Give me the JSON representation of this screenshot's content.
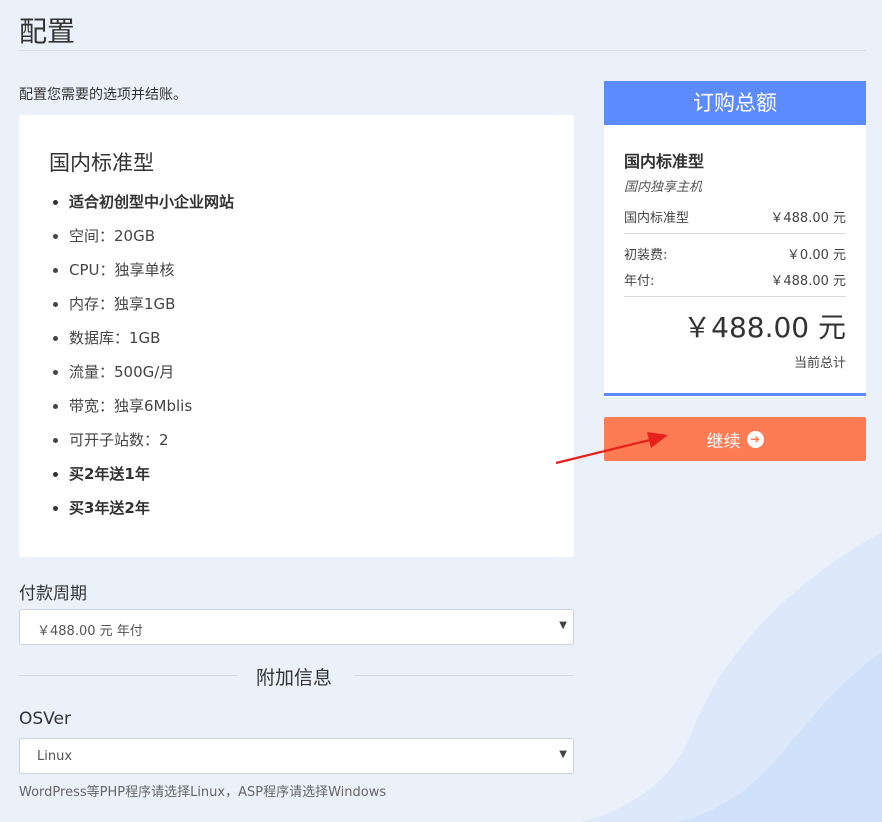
{
  "page": {
    "title": "配置",
    "intro": "配置您需要的选项并结账。"
  },
  "product": {
    "name": "国内标准型",
    "features": [
      {
        "text": "适合初创型中小企业网站",
        "bold": true
      },
      {
        "text": "空间：20GB",
        "bold": false
      },
      {
        "text": "CPU：独享单核",
        "bold": false
      },
      {
        "text": "内存：独享1GB",
        "bold": false
      },
      {
        "text": "数据库：1GB",
        "bold": false
      },
      {
        "text": "流量：500G/月",
        "bold": false
      },
      {
        "text": "带宽：独享6Mblis",
        "bold": false
      },
      {
        "text": "可开子站数：2",
        "bold": false
      },
      {
        "text": "买2年送1年",
        "bold": true
      },
      {
        "text": "买3年送2年",
        "bold": true
      }
    ]
  },
  "billing": {
    "label": "付款周期",
    "selected": "￥488.00 元 年付"
  },
  "additional": {
    "heading": "附加信息",
    "os_label": "OSVer",
    "os_selected": "Linux",
    "help": "WordPress等PHP程序请选择Linux，ASP程序请选择Windows"
  },
  "summary": {
    "heading": "订购总额",
    "product": "国内标准型",
    "group": "国内独享主机",
    "line_label": "国内标准型",
    "line_value": "￥488.00 元",
    "setup_label": "初装费:",
    "setup_value": "￥0.00 元",
    "annual_label": "年付:",
    "annual_value": "￥488.00 元",
    "total": "￥488.00 元",
    "total_label": "当前总计"
  },
  "actions": {
    "continue_label": "继续",
    "continue_icon": "arrow-circle-right-icon"
  },
  "colors": {
    "header_blue": "#5b8bff",
    "continue_orange": "#ff7b54",
    "annotation_arrow": "#e8201a"
  }
}
